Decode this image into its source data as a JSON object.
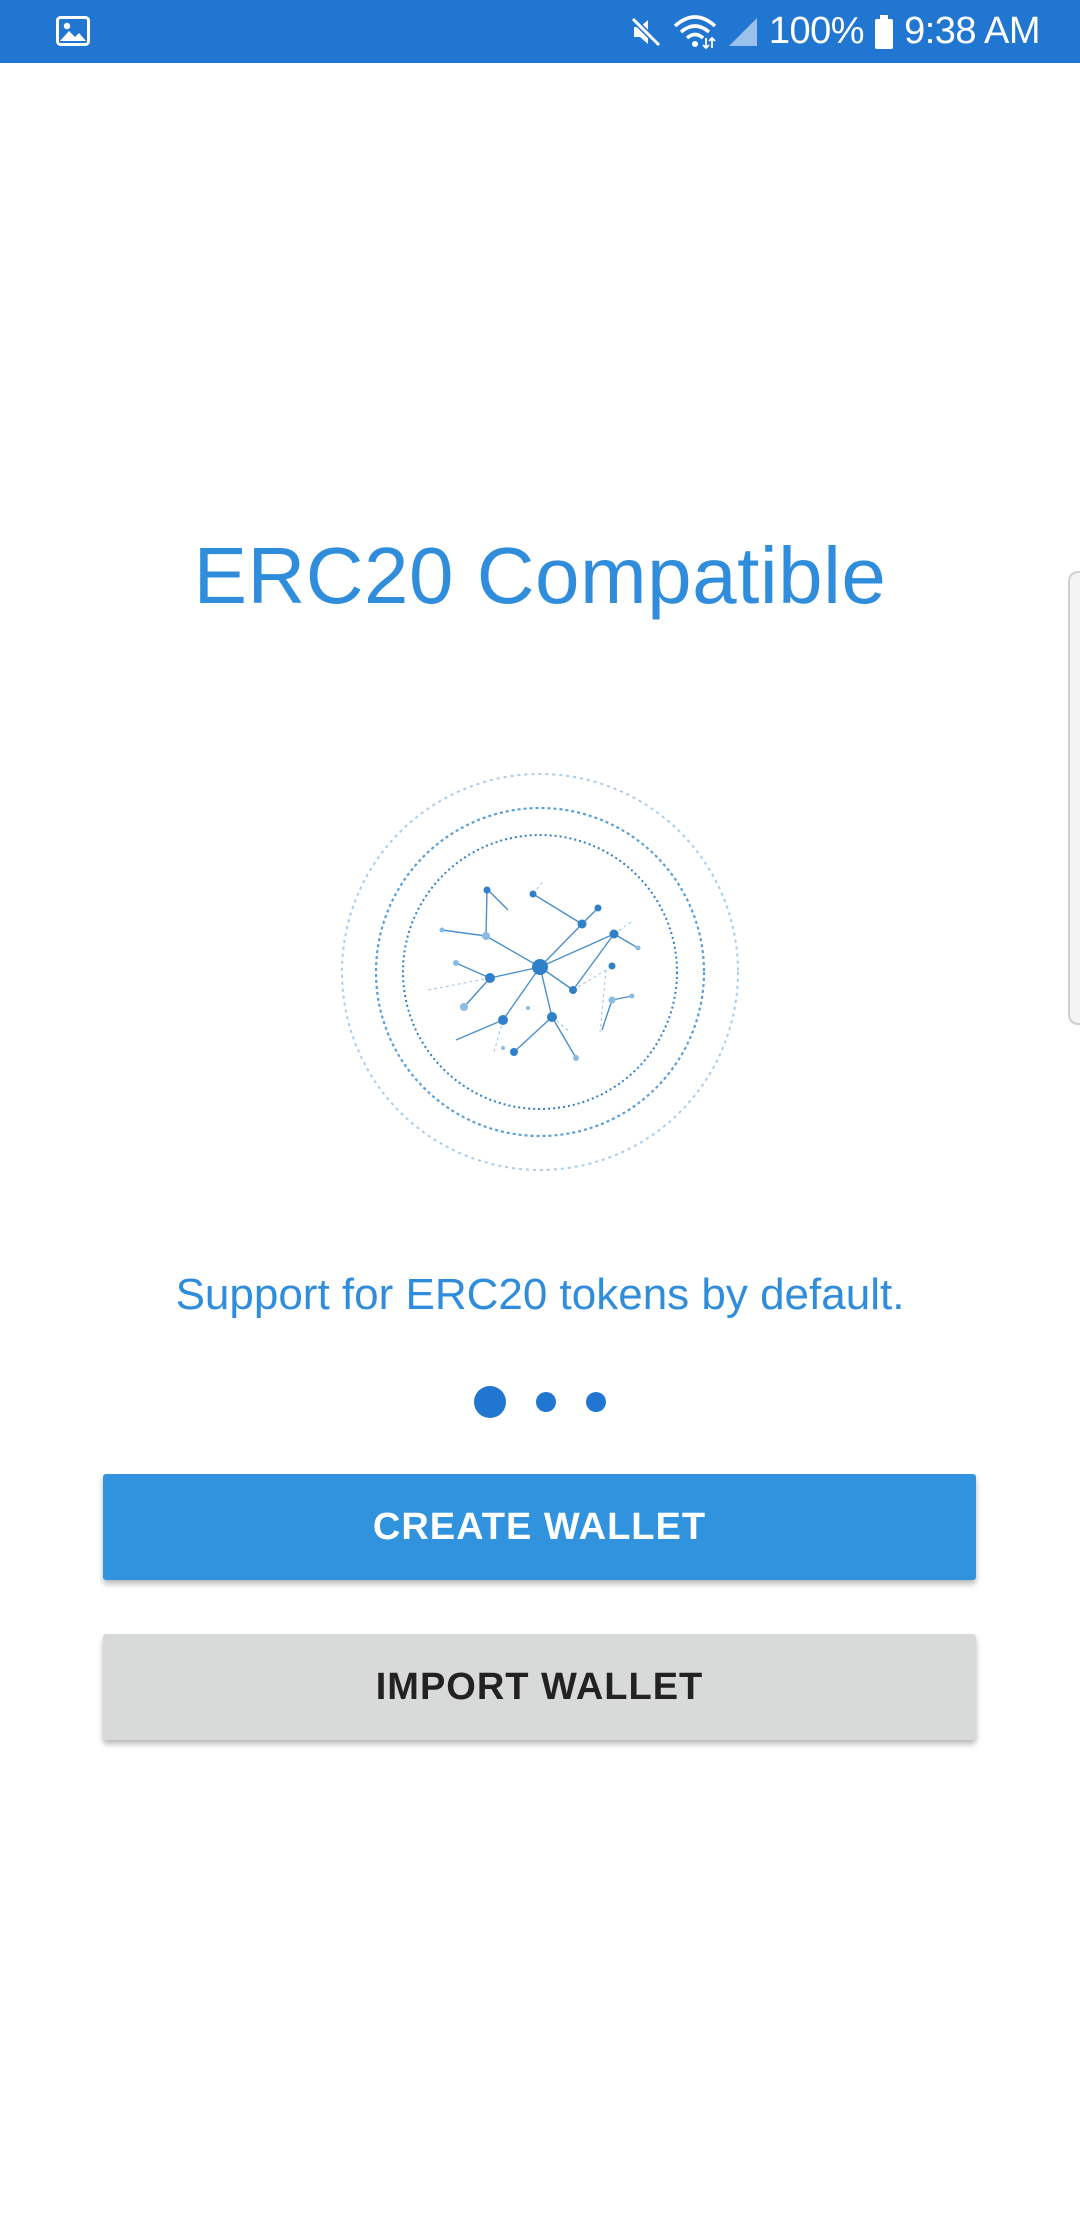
{
  "status_bar": {
    "battery": "100%",
    "time": "9:38 AM",
    "color": "#2176d2",
    "icons": [
      "gallery-icon",
      "mute-icon",
      "wifi-icon",
      "signal-icon",
      "battery-icon"
    ]
  },
  "onboarding": {
    "title": "ERC20 Compatible",
    "subtitle": "Support for ERC20 tokens by default.",
    "illustration_icon": "network-globe-icon",
    "pager": {
      "total": 3,
      "active_index": 0
    },
    "accent_color": "#2f8ddc"
  },
  "actions": {
    "create_label": "CREATE WALLET",
    "import_label": "IMPORT WALLET"
  }
}
